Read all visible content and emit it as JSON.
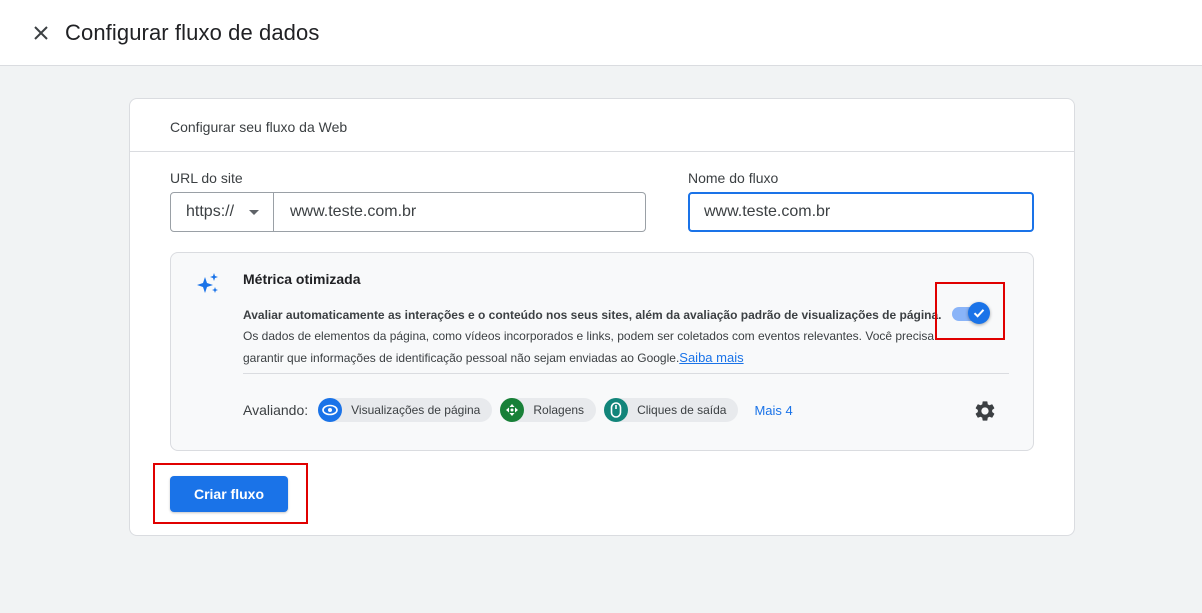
{
  "header": {
    "title": "Configurar fluxo de dados",
    "close_icon": "close-icon"
  },
  "card": {
    "header": "Configurar seu fluxo da Web",
    "url_label": "URL do site",
    "protocol_value": "https://",
    "url_value": "www.teste.com.br",
    "stream_name_label": "Nome do fluxo",
    "stream_name_value": "www.teste.com.br"
  },
  "metrics": {
    "icon": "sparkle-icon",
    "title": "Métrica otimizada",
    "desc_lead": "Avaliar automaticamente as interações e o conteúdo nos seus sites, além da avaliação padrão de visualizações de página.",
    "desc_rest": "Os dados de elementos da página, como vídeos incorporados e links, podem ser coletados com eventos relevantes. Você precisa garantir que informações de identificação pessoal não sejam enviadas ao Google.",
    "learn_more": "Saiba mais",
    "toggle_on": true,
    "measuring_label": "Avaliando:",
    "chips": [
      {
        "label": "Visualizações de página",
        "icon": "eye-icon",
        "color": "#1a73e8"
      },
      {
        "label": "Rolagens",
        "icon": "scroll-arrows-icon",
        "color": "#188038"
      },
      {
        "label": "Cliques de saída",
        "icon": "mouse-icon",
        "color": "#12857a"
      }
    ],
    "more": "Mais 4",
    "settings_icon": "gear-icon"
  },
  "actions": {
    "create_label": "Criar fluxo"
  },
  "colors": {
    "accent": "#1a73e8",
    "highlight": "#e00000"
  }
}
